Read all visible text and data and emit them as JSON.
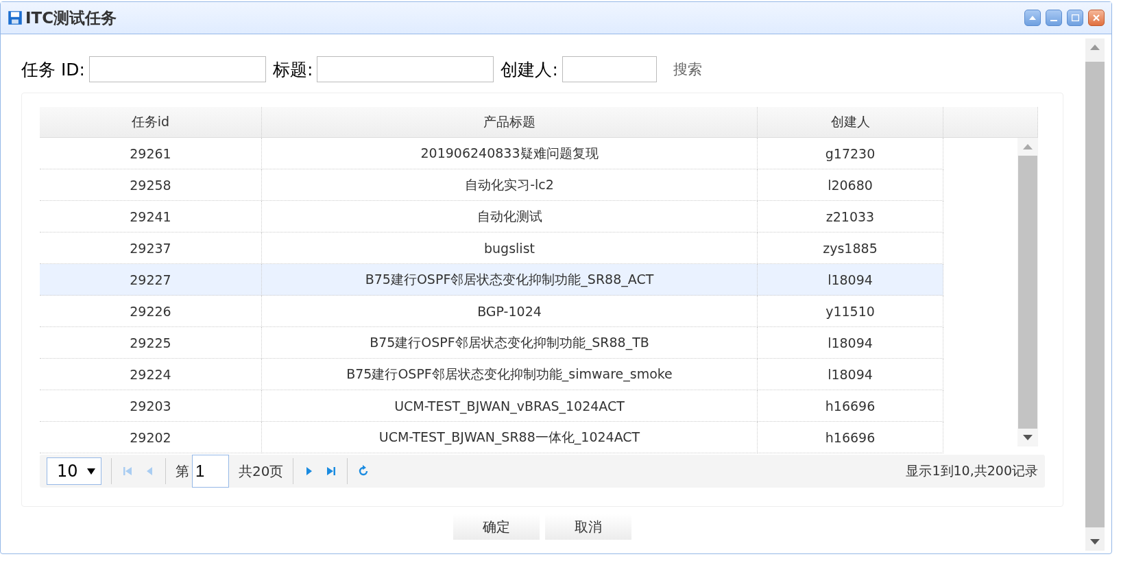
{
  "window": {
    "title": "ITC测试任务"
  },
  "search": {
    "fields": [
      {
        "label": "任务 ID:"
      },
      {
        "label": "标题:"
      },
      {
        "label": "创建人:"
      }
    ],
    "button": "搜索"
  },
  "table": {
    "columns": [
      "任务id",
      "产品标题",
      "创建人"
    ],
    "rows": [
      {
        "cells": [
          "29261",
          "201906240833疑难问题复现",
          "g17230"
        ],
        "selected": false
      },
      {
        "cells": [
          "29258",
          "自动化实习-lc2",
          "l20680"
        ],
        "selected": false
      },
      {
        "cells": [
          "29241",
          "自动化测试",
          "z21033"
        ],
        "selected": false
      },
      {
        "cells": [
          "29237",
          "bugslist",
          "zys1885"
        ],
        "selected": false
      },
      {
        "cells": [
          "29227",
          "B75建行OSPF邻居状态变化抑制功能_SR88_ACT",
          "l18094"
        ],
        "selected": true
      },
      {
        "cells": [
          "29226",
          "BGP-1024",
          "y11510"
        ],
        "selected": false
      },
      {
        "cells": [
          "29225",
          "B75建行OSPF邻居状态变化抑制功能_SR88_TB",
          "l18094"
        ],
        "selected": false
      },
      {
        "cells": [
          "29224",
          "B75建行OSPF邻居状态变化抑制功能_simware_smoke",
          "l18094"
        ],
        "selected": false
      },
      {
        "cells": [
          "29203",
          "UCM-TEST_BJWAN_vBRAS_1024ACT",
          "h16696"
        ],
        "selected": false
      },
      {
        "cells": [
          "29202",
          "UCM-TEST_BJWAN_SR88一体化_1024ACT",
          "h16696"
        ],
        "selected": false
      }
    ]
  },
  "pager": {
    "page_size": "10",
    "page_prefix": "第",
    "page": "1",
    "page_suffix": "共20页",
    "summary": "显示1到10,共200记录"
  },
  "buttons": [
    "确定",
    "取消"
  ]
}
